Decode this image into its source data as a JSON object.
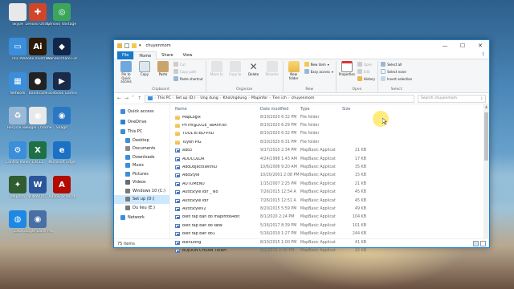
{
  "desktop_icons": [
    {
      "label": "Skype",
      "color": "#e8e8e8",
      "glyph": ""
    },
    {
      "label": "Lenovo Utility",
      "color": "#d14528",
      "glyph": "✚"
    },
    {
      "label": "Lenovo Vantage",
      "color": "#3ba55c",
      "glyph": "◎"
    },
    {
      "label": "This PC",
      "color": "#3b8ed9",
      "glyph": "▭"
    },
    {
      "label": "Adobe Illustrator",
      "color": "#2b1a07",
      "glyph": "Ai"
    },
    {
      "label": "Wondershare Filmora",
      "color": "#12264a",
      "glyph": "◆"
    },
    {
      "label": "Network",
      "color": "#3b8ed9",
      "glyph": "▦"
    },
    {
      "label": "Bandicam",
      "color": "#222222",
      "glyph": "●"
    },
    {
      "label": "Facebook Gaming",
      "color": "#1a2b4a",
      "glyph": "▶"
    },
    {
      "label": "Recycle Bin",
      "color": "#9ab9d6",
      "glyph": "♻"
    },
    {
      "label": "Google Chrome",
      "color": "#e8e8e8",
      "glyph": "◉"
    },
    {
      "label": "Snagit",
      "color": "#2b77c4",
      "glyph": "◉"
    },
    {
      "label": "Control Panel",
      "color": "#3b8ed9",
      "glyph": "⚙"
    },
    {
      "label": "EXCEL",
      "color": "#1e7145",
      "glyph": "X"
    },
    {
      "label": "Microsoft Edge",
      "color": "#1b72c4",
      "glyph": "e"
    },
    {
      "label": "Mapinfo",
      "color": "#2f5d2f",
      "glyph": "✦"
    },
    {
      "label": "WINWORD",
      "color": "#2b579a",
      "glyph": "W"
    },
    {
      "label": "Adobe Acrobat",
      "color": "#b30b00",
      "glyph": "A"
    },
    {
      "label": "Zalo",
      "color": "#1e88e5",
      "glyph": "◍"
    },
    {
      "label": "Google Earth Pro",
      "color": "#4a6fa5",
      "glyph": "◉"
    }
  ],
  "window": {
    "title": "chuyenmom",
    "controls": {
      "minimize": "—",
      "maximize": "☐",
      "close": "✕"
    }
  },
  "tabs": [
    "File",
    "Home",
    "Share",
    "View"
  ],
  "ribbon": {
    "clipboard": {
      "name": "Clipboard",
      "pin": "Pin to Quick access",
      "copy": "Copy",
      "paste": "Paste",
      "cut": "Cut",
      "copy_path": "Copy path",
      "paste_shortcut": "Paste shortcut"
    },
    "organize": {
      "name": "Organize",
      "move_to": "Move to",
      "copy_to": "Copy to",
      "delete": "Delete",
      "rename": "Rename"
    },
    "new": {
      "name": "New",
      "new_folder": "New folder",
      "new_item": "New item",
      "easy_access": "Easy access"
    },
    "open": {
      "name": "Open",
      "properties": "Properties",
      "open": "Open",
      "edit": "Edit",
      "history": "History"
    },
    "select": {
      "name": "Select",
      "select_all": "Select all",
      "select_none": "Select none",
      "invert": "Invert selection"
    }
  },
  "address": {
    "crumbs": [
      "This PC",
      "Set up (D:)",
      "Ung dung",
      "KhoUngdung",
      "Mapinfor",
      "Tien ich",
      "chuyenmom"
    ],
    "search_placeholder": "Search chuyenmom"
  },
  "nav_pane": [
    {
      "label": "Quick access",
      "color": "#3b8ed9",
      "indent": 0
    },
    {
      "label": "OneDrive",
      "color": "#2f7fd6",
      "indent": 0
    },
    {
      "label": "This PC",
      "color": "#3b8ed9",
      "indent": 0
    },
    {
      "label": "Desktop",
      "color": "#3b8ed9",
      "indent": 1
    },
    {
      "label": "Documents",
      "color": "#8a8a8a",
      "indent": 1
    },
    {
      "label": "Downloads",
      "color": "#3b8ed9",
      "indent": 1
    },
    {
      "label": "Music",
      "color": "#3b8ed9",
      "indent": 1
    },
    {
      "label": "Pictures",
      "color": "#3b8ed9",
      "indent": 1
    },
    {
      "label": "Videos",
      "color": "#6a6a6a",
      "indent": 1
    },
    {
      "label": "Windows 10 (C:)",
      "color": "#7a7a7a",
      "indent": 1
    },
    {
      "label": "Set up (D:)",
      "color": "#7a7a7a",
      "indent": 1,
      "selected": true
    },
    {
      "label": "Du lieu (E:)",
      "color": "#7a7a7a",
      "indent": 1
    },
    {
      "label": "Network",
      "color": "#3b8ed9",
      "indent": 0
    }
  ],
  "columns": {
    "name": "Name",
    "date": "Date modified",
    "type": "Type",
    "size": "Size"
  },
  "files": [
    {
      "name": "MapLogix",
      "date": "8/10/2020 6:32 PM",
      "type": "File folder",
      "size": "",
      "kind": "folder"
    },
    {
      "name": "PnTm@2018_TaiAnhToi",
      "date": "8/10/2020 6:29 PM",
      "type": "File folder",
      "size": "",
      "kind": "folder"
    },
    {
      "name": "TOOL BTBD-PXD",
      "date": "8/10/2020 6:32 PM",
      "type": "File folder",
      "size": "",
      "kind": "folder"
    },
    {
      "name": "Tuyen PIG",
      "date": "8/10/2020 6:31 PM",
      "type": "File folder",
      "size": "",
      "kind": "folder"
    },
    {
      "name": "add3",
      "date": "9/17/2010 2:34 PM",
      "type": "MapBasic Applicat",
      "size": "21 KB",
      "kind": "mbx"
    },
    {
      "name": "ADDCOLOR",
      "date": "4/24/1998 1:43 AM",
      "type": "MapBasic Applicat",
      "size": "17 KB",
      "kind": "mbx"
    },
    {
      "name": "AddObjectsWithID",
      "date": "10/6/2006 9:20 AM",
      "type": "MapBasic Applicat",
      "size": "35 KB",
      "kind": "mbx"
    },
    {
      "name": "AddStyle",
      "date": "10/20/2001 2:08 PM",
      "type": "MapBasic Applicat",
      "size": "15 KB",
      "kind": "mbx"
    },
    {
      "name": "AUTOMENU",
      "date": "1/15/2007 2:25 PM",
      "type": "MapBasic Applicat",
      "size": "21 KB",
      "kind": "mbx"
    },
    {
      "name": "AutoStyle Idlr _ No",
      "date": "7/26/2015 12:54 A",
      "type": "MapBasic Applicat",
      "size": "45 KB",
      "kind": "mbx"
    },
    {
      "name": "AutoStyle Idlr",
      "date": "7/26/2015 12:51 A",
      "type": "MapBasic Applicat",
      "size": "45 KB",
      "kind": "mbx"
    },
    {
      "name": "AutoStyleV2",
      "date": "8/20/2015 5:59 PM",
      "type": "MapBasic Applicat",
      "size": "49 KB",
      "kind": "mbx"
    },
    {
      "name": "bien tap ban do mapinfo64bit",
      "date": "8/1/2020 2:24 PM",
      "type": "MapBasic Applicat",
      "size": "104 KB",
      "kind": "mbx"
    },
    {
      "name": "bien tap ban do New",
      "date": "5/16/2017 8:39 PM",
      "type": "MapBasic Applicat",
      "size": "101 KB",
      "kind": "mbx"
    },
    {
      "name": "bien tap ban do1",
      "date": "5/16/2019 1:27 PM",
      "type": "MapBasic Applicat",
      "size": "244 KB",
      "kind": "mbx"
    },
    {
      "name": "BienDong",
      "date": "8/10/2015 1:00 PM",
      "type": "MapBasic Applicat",
      "size": "41 KB",
      "kind": "mbx"
    },
    {
      "name": "BOJOON CHUAN TRINH",
      "date": "9/1/2015 2:30 PM",
      "type": "MapBasic Applicat",
      "size": "22 KB",
      "kind": "mbx"
    }
  ],
  "status": {
    "count": "75 items"
  }
}
